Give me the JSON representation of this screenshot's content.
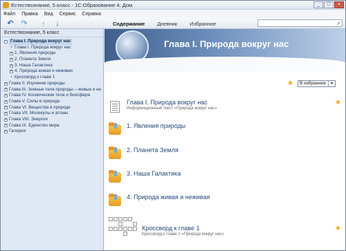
{
  "window": {
    "title": "Естествознание, 5 класс - 1С:Образование 4. Дом",
    "controls": {
      "minimize": "_",
      "maximize": "□",
      "close": "×"
    }
  },
  "menu": [
    "Файл",
    "Правка",
    "Вид",
    "Сервис",
    "Справка"
  ],
  "toolbar": {
    "tabs": [
      "Содержание",
      "Дневник",
      "Избранное"
    ],
    "active_tab": "Содержание",
    "search": {
      "value": "",
      "placeholder": ""
    }
  },
  "sidebar": {
    "header": "Естествознание, 5 класс",
    "tree": [
      {
        "label": "Глава I. Природа вокруг нас",
        "level": 0,
        "marker": "−",
        "selected": true
      },
      {
        "label": "Глава I. Природа вокруг нас",
        "level": 1,
        "marker": "•",
        "selected": false
      },
      {
        "label": "1. Явления природы",
        "level": 1,
        "marker": "+",
        "selected": false
      },
      {
        "label": "2. Планета Земля",
        "level": 1,
        "marker": "+",
        "selected": false
      },
      {
        "label": "3. Наша Галактика",
        "level": 1,
        "marker": "+",
        "selected": false
      },
      {
        "label": "4. Природа живая и неживая",
        "level": 1,
        "marker": "+",
        "selected": false
      },
      {
        "label": "Кроссворд к главе 1",
        "level": 1,
        "marker": "•",
        "selected": false
      },
      {
        "label": "Глава II. Изучение природы",
        "level": 0,
        "marker": "+",
        "selected": false
      },
      {
        "label": "Глава III. Земные тела природы – живые и не",
        "level": 0,
        "marker": "+",
        "selected": false
      },
      {
        "label": "Глава IV. Космические тела и биосфера",
        "level": 0,
        "marker": "+",
        "selected": false
      },
      {
        "label": "Глава V. Силы в природе",
        "level": 0,
        "marker": "+",
        "selected": false
      },
      {
        "label": "Глава VI. Вещества в природе",
        "level": 0,
        "marker": "+",
        "selected": false
      },
      {
        "label": "Глава VII. Молекулы и атомы",
        "level": 0,
        "marker": "+",
        "selected": false
      },
      {
        "label": "Глава VIII. Энергия",
        "level": 0,
        "marker": "+",
        "selected": false
      },
      {
        "label": "Глава IX. Единство мира",
        "level": 0,
        "marker": "+",
        "selected": false
      },
      {
        "label": "Галерея",
        "level": 0,
        "marker": "+",
        "selected": false
      }
    ]
  },
  "content": {
    "banner_title": "Глава I. Природа вокруг нас",
    "favorites_select": "В избранное",
    "items": [
      {
        "type": "document",
        "title": "Глава I. Природа вокруг нас",
        "subtitle": "Информационный текст «Природа вокруг нас»",
        "starred": true
      },
      {
        "type": "folder",
        "title": "1. Явления природы",
        "subtitle": "",
        "starred": false
      },
      {
        "type": "folder",
        "title": "2. Планета Земля",
        "subtitle": "",
        "starred": false
      },
      {
        "type": "folder",
        "title": "3. Наша Галактика",
        "subtitle": "",
        "starred": false
      },
      {
        "type": "folder",
        "title": "4. Природа живая и неживая",
        "subtitle": "",
        "starred": false
      },
      {
        "type": "crossword",
        "title": "Кроссворд к главе 1",
        "subtitle": "Кроссворд к главе 1 «Природа вокруг нас»",
        "starred": true
      }
    ]
  },
  "colors": {
    "link": "#234a7a",
    "star": "#f0a800",
    "banner": "#3f5f8c"
  }
}
